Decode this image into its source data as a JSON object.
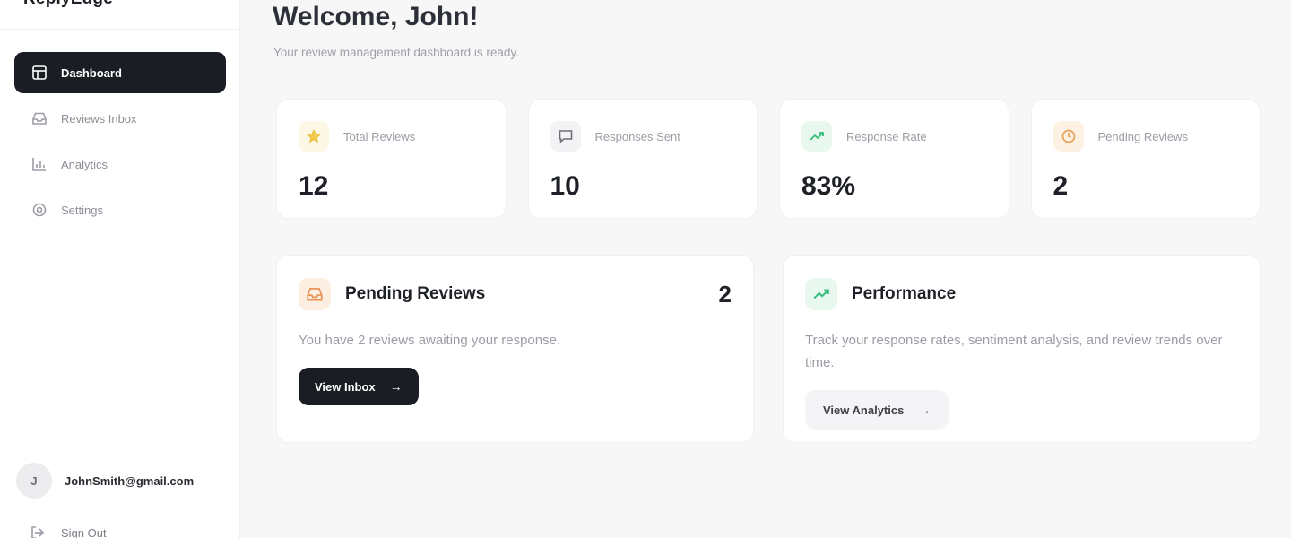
{
  "app": {
    "brand": "ReplyEdge"
  },
  "sidebar": {
    "items": [
      {
        "label": "Dashboard",
        "icon": "grid-icon",
        "active": true
      },
      {
        "label": "Reviews Inbox",
        "icon": "inbox-icon",
        "active": false
      },
      {
        "label": "Analytics",
        "icon": "bar-chart-icon",
        "active": false
      },
      {
        "label": "Settings",
        "icon": "gear-icon",
        "active": false
      }
    ],
    "user": {
      "initial": "J",
      "email": "JohnSmith@gmail.com"
    },
    "signout_label": "Sign Out"
  },
  "header": {
    "title": "Welcome, John!",
    "subtitle": "Your review management dashboard is ready."
  },
  "stats": [
    {
      "label": "Total Reviews",
      "value": "12",
      "icon": "star-icon",
      "color": "#f2c94c",
      "bg": "#fdf8e6"
    },
    {
      "label": "Responses Sent",
      "value": "10",
      "icon": "message-icon",
      "color": "#6b6e76",
      "bg": "#f3f3f5"
    },
    {
      "label": "Response Rate",
      "value": "83%",
      "icon": "trend-up-icon",
      "color": "#34c07a",
      "bg": "#e9f8ef"
    },
    {
      "label": "Pending Reviews",
      "value": "2",
      "icon": "clock-icon",
      "color": "#e8a15a",
      "bg": "#fdf1e4"
    }
  ],
  "panels": {
    "pending": {
      "title": "Pending Reviews",
      "count": "2",
      "text": "You have 2 reviews awaiting your response.",
      "button": "View Inbox",
      "icon": "inbox-icon",
      "color": "#e8955a",
      "bg": "#fdeee2"
    },
    "performance": {
      "title": "Performance",
      "text": "Track your response rates, sentiment analysis, and review trends over time.",
      "button": "View Analytics",
      "icon": "trend-up-icon",
      "color": "#34c07a",
      "bg": "#e9f8ef"
    }
  },
  "icons": {
    "arrow": "→"
  }
}
